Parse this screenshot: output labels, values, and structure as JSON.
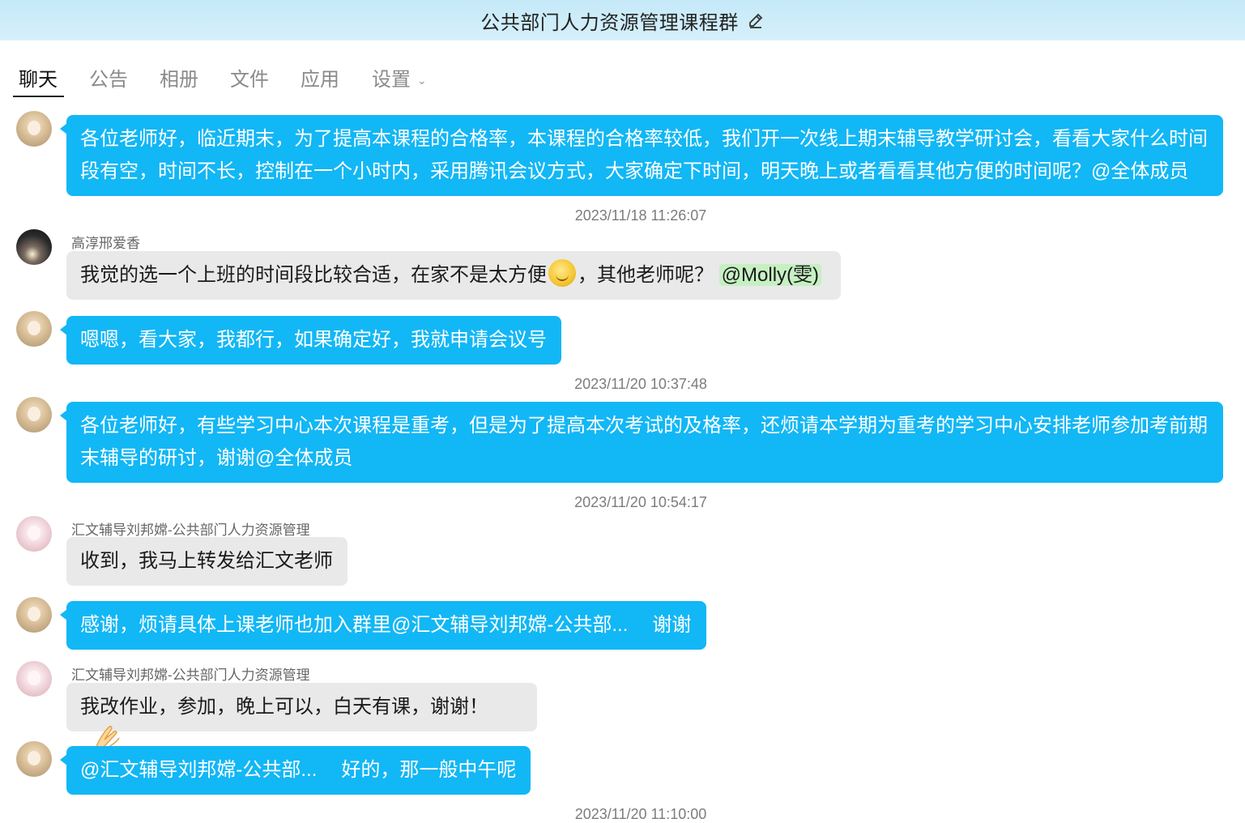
{
  "window": {
    "title": "公共部门人力资源管理课程群",
    "edit_icon": "pencil-icon"
  },
  "tabs": [
    {
      "label": "聊天",
      "active": true
    },
    {
      "label": "公告"
    },
    {
      "label": "相册"
    },
    {
      "label": "文件"
    },
    {
      "label": "应用"
    },
    {
      "label": "设置",
      "dropdown": true
    }
  ],
  "messages": [
    {
      "type": "self",
      "lines": [
        "各位老师好，临近期末，为了提高本课程的合格率，本课程的合格率较低，我们开一次线上期末辅导教学研讨会，看看大家什么时间",
        "段有空，时间不长，控制在一个小时内，采用腾讯会议方式，大家确定下时间，明天晚上或者看看其他方便的时间呢？@全体成员"
      ]
    },
    {
      "type": "time",
      "text": "2023/11/18 11:26:07"
    },
    {
      "type": "other",
      "sender": "高淳邢爱香",
      "text_before": "我觉的选一个上班的时间段比较合适，在家不是太方便",
      "emoji": "smile-emoji",
      "text_after": "，其他老师呢？",
      "mention": "@Molly(雯)"
    },
    {
      "type": "self",
      "text": "嗯嗯，看大家，我都行，如果确定好，我就申请会议号"
    },
    {
      "type": "time",
      "text": "2023/11/20 10:37:48"
    },
    {
      "type": "self",
      "lines": [
        "各位老师好，有些学习中心本次课程是重考，但是为了提高本次考试的及格率，还烦请本学期为重考的学习中心安排老师参加考前期",
        "末辅导的研讨，谢谢@全体成员"
      ]
    },
    {
      "type": "time",
      "text": "2023/11/20 10:54:17"
    },
    {
      "type": "other",
      "sender": "汇文辅导刘邦嫦-公共部门人力资源管理",
      "text": "收到，我马上转发给汇文老师"
    },
    {
      "type": "self",
      "text": "感谢，烦请具体上课老师也加入群里@汇文辅导刘邦嫦-公共部...",
      "text_tail": "谢谢"
    },
    {
      "type": "other",
      "sender": "汇文辅导刘邦嫦-公共部门人力资源管理",
      "text": "我改作业，参加，晚上可以，白天有课，谢谢！",
      "emoji": "clasped-hands-emoji"
    },
    {
      "type": "self",
      "text": "@汇文辅导刘邦嫦-公共部...",
      "text_tail": "好的，那一般中午呢"
    },
    {
      "type": "time",
      "text": "2023/11/20 11:10:00"
    }
  ],
  "colors": {
    "self_bubble": "#12b7f5",
    "other_bubble": "#e9e9e9",
    "mention_bg": "#c6f0c2",
    "title_bar": "#c5e9f8"
  }
}
